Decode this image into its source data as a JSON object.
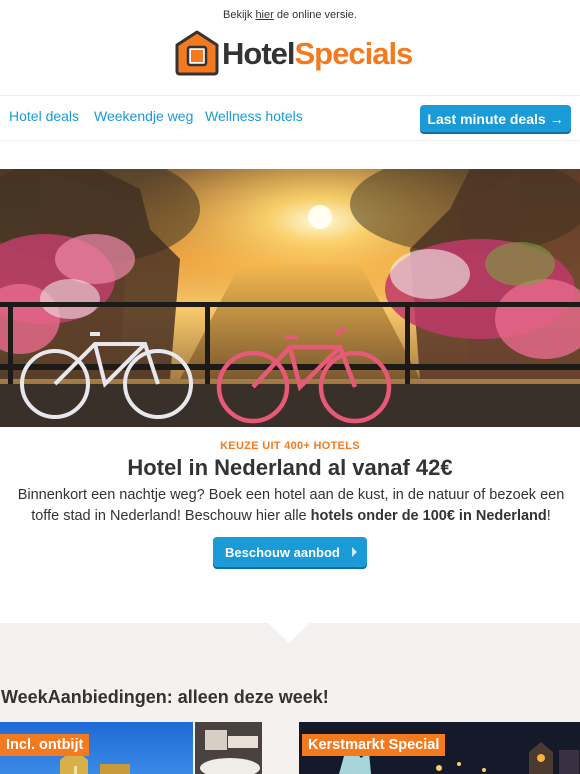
{
  "preheader": {
    "before": "Bekijk",
    "link": "hier",
    "after": "de online versie."
  },
  "logo": {
    "hotel": "Hotel",
    "specials": "Specials"
  },
  "nav": {
    "items": [
      "Hotel deals",
      "Weekendje weg",
      "Wellness hotels"
    ],
    "button": "Last minute deals →"
  },
  "hero": {
    "kicker": "KEUZE UIT 400+ HOTELS",
    "headline": "Hotel in Nederland al vanaf 42€",
    "body_start": "Binnenkort een nachtje weg? Boek een hotel aan de kust, in de natuur of bezoek een toffe stad in Nederland! Beschouw hier alle ",
    "body_bold": "hotels onder de 100€ in Nederland",
    "body_end": "!",
    "cta": "Beschouw aanbod"
  },
  "week": {
    "title": "WeekAanbiedingen: alleen deze week!",
    "cards": [
      "Incl. ontbijt",
      "Kerstmarkt Special"
    ]
  },
  "colors": {
    "brand_orange": "#f47a20",
    "link_blue": "#1a9ad6",
    "beige_band": "#f4f1ee"
  }
}
